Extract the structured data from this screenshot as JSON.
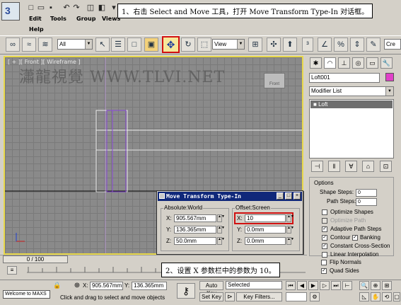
{
  "menu": {
    "items_row1": [
      "Edit",
      "Tools",
      "Group",
      "Views"
    ],
    "items_row2": [
      "Help"
    ]
  },
  "callouts": {
    "step1": "1、右击 Select and Move 工具，打开 Move Transform Type-In 对话框。",
    "step2": "2、设置 X 参数栏中的参数为 10。"
  },
  "toolbar": {
    "selection_filter": "All",
    "reference_coord": "View",
    "named_selection": "Cre"
  },
  "viewport": {
    "label": "[ + ][ Front ][ Wireframe ]",
    "watermark": "瀟龍視覺 WWW.TLVI.NET",
    "viewcube_label": "Front"
  },
  "command_panel": {
    "object_name": "Loft001",
    "modifier_list": "Modifier List",
    "stack_item": "Loft",
    "rollout_title": "Options",
    "shape_steps_label": "Shape Steps:",
    "shape_steps_value": "0",
    "path_steps_label": "Path Steps:",
    "path_steps_value": "0",
    "options": [
      {
        "label": "Optimize Shapes",
        "checked": false,
        "enabled": true
      },
      {
        "label": "Optimize Path",
        "checked": false,
        "enabled": false
      },
      {
        "label": "Adaptive Path Steps",
        "checked": true,
        "enabled": true
      },
      {
        "label": "Contour",
        "checked": true,
        "enabled": true
      },
      {
        "label": "Banking",
        "checked": true,
        "enabled": true
      },
      {
        "label": "Constant Cross-Section",
        "checked": true,
        "enabled": true
      },
      {
        "label": "Linear Interpolation",
        "checked": false,
        "enabled": true
      },
      {
        "label": "Flip Normals",
        "checked": false,
        "enabled": true
      },
      {
        "label": "Quad Sides",
        "checked": true,
        "enabled": true
      }
    ]
  },
  "dialog": {
    "title": "Move Transform Type-In",
    "absolute_title": "Absolute:World",
    "offset_title": "Offset:Screen",
    "abs_x_label": "X:",
    "abs_x": "905.567mm",
    "abs_y_label": "Y:",
    "abs_y": "136.365mm",
    "abs_z_label": "Z:",
    "abs_z": "50.0mm",
    "off_x_label": "X:",
    "off_x": "10",
    "off_y_label": "Y:",
    "off_y": "0.0mm",
    "off_z_label": "Z:",
    "off_z": "0.0mm"
  },
  "timeline": {
    "slider": "0 / 100"
  },
  "status_bar": {
    "welcome": "Welcome to MAXS",
    "prompt": "Click and drag to select and move objects",
    "x_label": "X:",
    "x_value": "905.567mm",
    "y_label": "Y:",
    "y_value": "136.365mm",
    "auto_key": "Auto Key",
    "set_key": "Set Key",
    "key_mode": "Selected",
    "key_filters": "Key Filters..."
  },
  "colors": {
    "highlight_red": "#d01010",
    "viewport_border": "#e8d84a",
    "dialog_title": "#10287a",
    "object_swatch": "#e040c8"
  }
}
